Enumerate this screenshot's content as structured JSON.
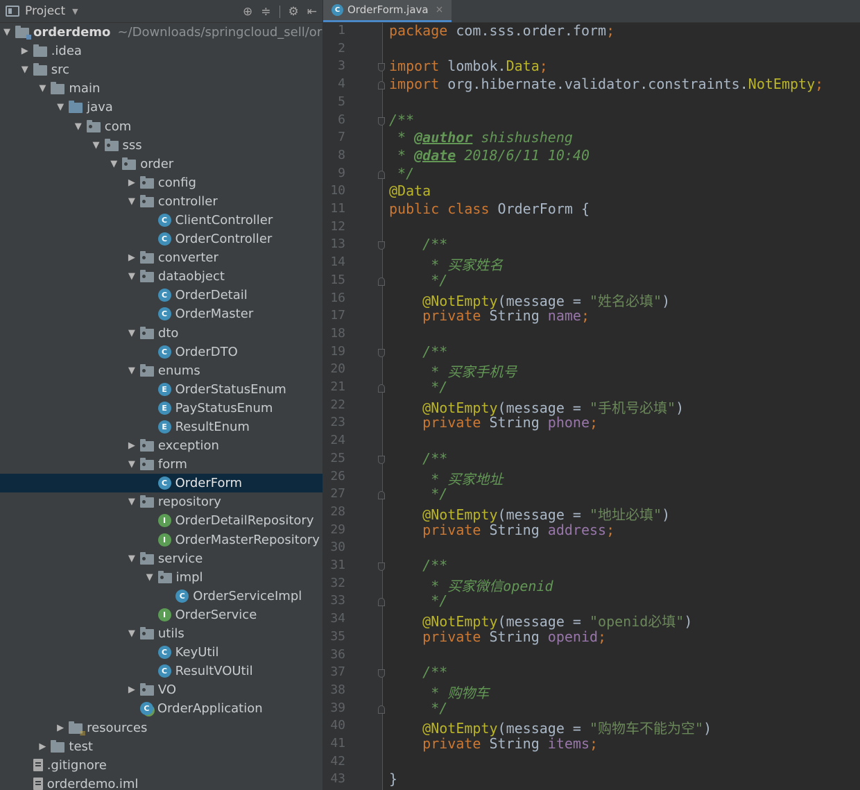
{
  "project_panel": {
    "title": "Project",
    "tools": [
      "⊕",
      "≑",
      "⚙",
      "⇤"
    ],
    "tree": [
      {
        "depth": 0,
        "arrow": "▼",
        "icon": "module-folder",
        "label": "orderdemo",
        "bold": true,
        "path": "~/Downloads/springcloud_sell/ord"
      },
      {
        "depth": 1,
        "arrow": "▶",
        "icon": "folder",
        "label": ".idea"
      },
      {
        "depth": 1,
        "arrow": "▼",
        "icon": "folder",
        "label": "src"
      },
      {
        "depth": 2,
        "arrow": "▼",
        "icon": "folder",
        "label": "main"
      },
      {
        "depth": 3,
        "arrow": "▼",
        "icon": "source-folder",
        "label": "java"
      },
      {
        "depth": 4,
        "arrow": "▼",
        "icon": "package",
        "label": "com"
      },
      {
        "depth": 5,
        "arrow": "▼",
        "icon": "package",
        "label": "sss"
      },
      {
        "depth": 6,
        "arrow": "▼",
        "icon": "package",
        "label": "order"
      },
      {
        "depth": 7,
        "arrow": "▶",
        "icon": "package",
        "label": "config"
      },
      {
        "depth": 7,
        "arrow": "▼",
        "icon": "package",
        "label": "controller"
      },
      {
        "depth": 8,
        "arrow": "",
        "icon": "class",
        "label": "ClientController"
      },
      {
        "depth": 8,
        "arrow": "",
        "icon": "class",
        "label": "OrderController"
      },
      {
        "depth": 7,
        "arrow": "▶",
        "icon": "package",
        "label": "converter"
      },
      {
        "depth": 7,
        "arrow": "▼",
        "icon": "package",
        "label": "dataobject"
      },
      {
        "depth": 8,
        "arrow": "",
        "icon": "class",
        "label": "OrderDetail"
      },
      {
        "depth": 8,
        "arrow": "",
        "icon": "class",
        "label": "OrderMaster"
      },
      {
        "depth": 7,
        "arrow": "▼",
        "icon": "package",
        "label": "dto"
      },
      {
        "depth": 8,
        "arrow": "",
        "icon": "class",
        "label": "OrderDTO"
      },
      {
        "depth": 7,
        "arrow": "▼",
        "icon": "package",
        "label": "enums"
      },
      {
        "depth": 8,
        "arrow": "",
        "icon": "enum",
        "label": "OrderStatusEnum"
      },
      {
        "depth": 8,
        "arrow": "",
        "icon": "enum",
        "label": "PayStatusEnum"
      },
      {
        "depth": 8,
        "arrow": "",
        "icon": "enum",
        "label": "ResultEnum"
      },
      {
        "depth": 7,
        "arrow": "▶",
        "icon": "package",
        "label": "exception"
      },
      {
        "depth": 7,
        "arrow": "▼",
        "icon": "package",
        "label": "form"
      },
      {
        "depth": 8,
        "arrow": "",
        "icon": "class",
        "label": "OrderForm",
        "selected": true
      },
      {
        "depth": 7,
        "arrow": "▼",
        "icon": "package",
        "label": "repository"
      },
      {
        "depth": 8,
        "arrow": "",
        "icon": "interface",
        "label": "OrderDetailRepository"
      },
      {
        "depth": 8,
        "arrow": "",
        "icon": "interface",
        "label": "OrderMasterRepository"
      },
      {
        "depth": 7,
        "arrow": "▼",
        "icon": "package",
        "label": "service"
      },
      {
        "depth": 8,
        "arrow": "▼",
        "icon": "package",
        "label": "impl"
      },
      {
        "depth": 9,
        "arrow": "",
        "icon": "class",
        "label": "OrderServiceImpl"
      },
      {
        "depth": 8,
        "arrow": "",
        "icon": "interface",
        "label": "OrderService"
      },
      {
        "depth": 7,
        "arrow": "▼",
        "icon": "package",
        "label": "utils"
      },
      {
        "depth": 8,
        "arrow": "",
        "icon": "class",
        "label": "KeyUtil"
      },
      {
        "depth": 8,
        "arrow": "",
        "icon": "class",
        "label": "ResultVOUtil"
      },
      {
        "depth": 7,
        "arrow": "▶",
        "icon": "package",
        "label": "VO"
      },
      {
        "depth": 7,
        "arrow": "",
        "icon": "spring-app",
        "label": "OrderApplication"
      },
      {
        "depth": 3,
        "arrow": "▶",
        "icon": "resources-folder",
        "label": "resources"
      },
      {
        "depth": 2,
        "arrow": "▶",
        "icon": "folder",
        "label": "test"
      },
      {
        "depth": 1,
        "arrow": "",
        "icon": "file",
        "label": ".gitignore"
      },
      {
        "depth": 1,
        "arrow": "",
        "icon": "file",
        "label": "orderdemo.iml"
      }
    ]
  },
  "editor": {
    "tab": {
      "label": "OrderForm.java",
      "close": "×",
      "badge": "C"
    },
    "line_numbers": [
      "1",
      "2",
      "3",
      "4",
      "5",
      "6",
      "7",
      "8",
      "9",
      "10",
      "11",
      "12",
      "13",
      "14",
      "15",
      "16",
      "17",
      "18",
      "19",
      "20",
      "21",
      "22",
      "23",
      "24",
      "25",
      "26",
      "27",
      "28",
      "29",
      "30",
      "31",
      "32",
      "33",
      "34",
      "35",
      "36",
      "37",
      "38",
      "39",
      "40",
      "41",
      "42",
      "43"
    ],
    "fold_markers": [
      {
        "line": 3,
        "kind": "open"
      },
      {
        "line": 4,
        "kind": "close"
      },
      {
        "line": 6,
        "kind": "open"
      },
      {
        "line": 9,
        "kind": "close"
      },
      {
        "line": 13,
        "kind": "open"
      },
      {
        "line": 15,
        "kind": "close"
      },
      {
        "line": 19,
        "kind": "open"
      },
      {
        "line": 21,
        "kind": "close"
      },
      {
        "line": 25,
        "kind": "open"
      },
      {
        "line": 27,
        "kind": "close"
      },
      {
        "line": 31,
        "kind": "open"
      },
      {
        "line": 33,
        "kind": "close"
      },
      {
        "line": 37,
        "kind": "open"
      },
      {
        "line": 39,
        "kind": "close"
      }
    ],
    "code_lines": [
      [
        [
          "kw",
          "package"
        ],
        [
          "plain",
          " com.sss.order.form"
        ],
        [
          "kw",
          ";"
        ]
      ],
      [],
      [
        [
          "kw",
          "import"
        ],
        [
          "plain",
          " lombok."
        ],
        [
          "ann",
          "Data"
        ],
        [
          "kw",
          ";"
        ]
      ],
      [
        [
          "kw",
          "import"
        ],
        [
          "plain",
          " org.hibernate.validator.constraints."
        ],
        [
          "ann",
          "NotEmpty"
        ],
        [
          "kw",
          ";"
        ]
      ],
      [],
      [
        [
          "cm",
          "/**"
        ]
      ],
      [
        [
          "cm",
          " * "
        ],
        [
          "tag",
          "@author"
        ],
        [
          "cm",
          " shishusheng"
        ]
      ],
      [
        [
          "cm",
          " * "
        ],
        [
          "tag",
          "@date"
        ],
        [
          "cm",
          " 2018/6/11 10:40"
        ]
      ],
      [
        [
          "cm",
          " */"
        ]
      ],
      [
        [
          "ann",
          "@Data"
        ]
      ],
      [
        [
          "kw",
          "public class"
        ],
        [
          "plain",
          " OrderForm {"
        ]
      ],
      [],
      [
        [
          "cm",
          "    /**"
        ]
      ],
      [
        [
          "cm",
          "     * 买家姓名"
        ]
      ],
      [
        [
          "cm",
          "     */"
        ]
      ],
      [
        [
          "ann",
          "    @NotEmpty"
        ],
        [
          "plain",
          "(message = "
        ],
        [
          "str",
          "\"姓名必填\""
        ],
        [
          "plain",
          ")"
        ]
      ],
      [
        [
          "kw",
          "    private"
        ],
        [
          "plain",
          " String "
        ],
        [
          "field",
          "name"
        ],
        [
          "kw",
          ";"
        ]
      ],
      [],
      [
        [
          "cm",
          "    /**"
        ]
      ],
      [
        [
          "cm",
          "     * 买家手机号"
        ]
      ],
      [
        [
          "cm",
          "     */"
        ]
      ],
      [
        [
          "ann",
          "    @NotEmpty"
        ],
        [
          "plain",
          "(message = "
        ],
        [
          "str",
          "\"手机号必填\""
        ],
        [
          "plain",
          ")"
        ]
      ],
      [
        [
          "kw",
          "    private"
        ],
        [
          "plain",
          " String "
        ],
        [
          "field",
          "phone"
        ],
        [
          "kw",
          ";"
        ]
      ],
      [],
      [
        [
          "cm",
          "    /**"
        ]
      ],
      [
        [
          "cm",
          "     * 买家地址"
        ]
      ],
      [
        [
          "cm",
          "     */"
        ]
      ],
      [
        [
          "ann",
          "    @NotEmpty"
        ],
        [
          "plain",
          "(message = "
        ],
        [
          "str",
          "\"地址必填\""
        ],
        [
          "plain",
          ")"
        ]
      ],
      [
        [
          "kw",
          "    private"
        ],
        [
          "plain",
          " String "
        ],
        [
          "field",
          "address"
        ],
        [
          "kw",
          ";"
        ]
      ],
      [],
      [
        [
          "cm",
          "    /**"
        ]
      ],
      [
        [
          "cm",
          "     * 买家微信openid"
        ]
      ],
      [
        [
          "cm",
          "     */"
        ]
      ],
      [
        [
          "ann",
          "    @NotEmpty"
        ],
        [
          "plain",
          "(message = "
        ],
        [
          "str",
          "\"openid必填\""
        ],
        [
          "plain",
          ")"
        ]
      ],
      [
        [
          "kw",
          "    private"
        ],
        [
          "plain",
          " String "
        ],
        [
          "field",
          "openid"
        ],
        [
          "kw",
          ";"
        ]
      ],
      [],
      [
        [
          "cm",
          "    /**"
        ]
      ],
      [
        [
          "cm",
          "     * 购物车"
        ]
      ],
      [
        [
          "cm",
          "     */"
        ]
      ],
      [
        [
          "ann",
          "    @NotEmpty"
        ],
        [
          "plain",
          "(message = "
        ],
        [
          "str",
          "\"购物车不能为空\""
        ],
        [
          "plain",
          ")"
        ]
      ],
      [
        [
          "kw",
          "    private"
        ],
        [
          "plain",
          " String "
        ],
        [
          "field",
          "items"
        ],
        [
          "kw",
          ";"
        ]
      ],
      [],
      [
        [
          "plain",
          "}"
        ]
      ]
    ],
    "colors": {
      "keyword": "#cc7832",
      "comment": "#629755",
      "annotation": "#bbb529",
      "string": "#6a8759",
      "field": "#9876aa",
      "text": "#a9b7c6"
    }
  }
}
